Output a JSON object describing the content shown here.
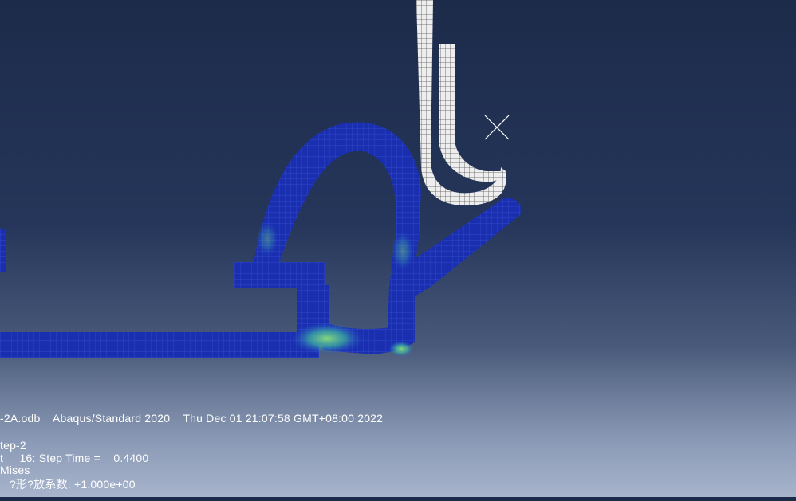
{
  "viewport": {
    "description_lines": {
      "odb_line": "-2A.odb    Abaqus/Standard 2020    Thu Dec 01 21:07:58 GMT+08:00 2022",
      "step_line": "tep-2",
      "increment_line": "t     16: Step Time =    0.4400",
      "variable_line": "Mises",
      "deform_line": "?形?放系数: +1.000e+00"
    },
    "colors": {
      "mesh_blue": "#1a2fb0",
      "mesh_line": "#3a55d8",
      "hot_green": "#5ad07a",
      "rigid_surface": "#e8e8e8",
      "marker": "#ffffff"
    }
  }
}
